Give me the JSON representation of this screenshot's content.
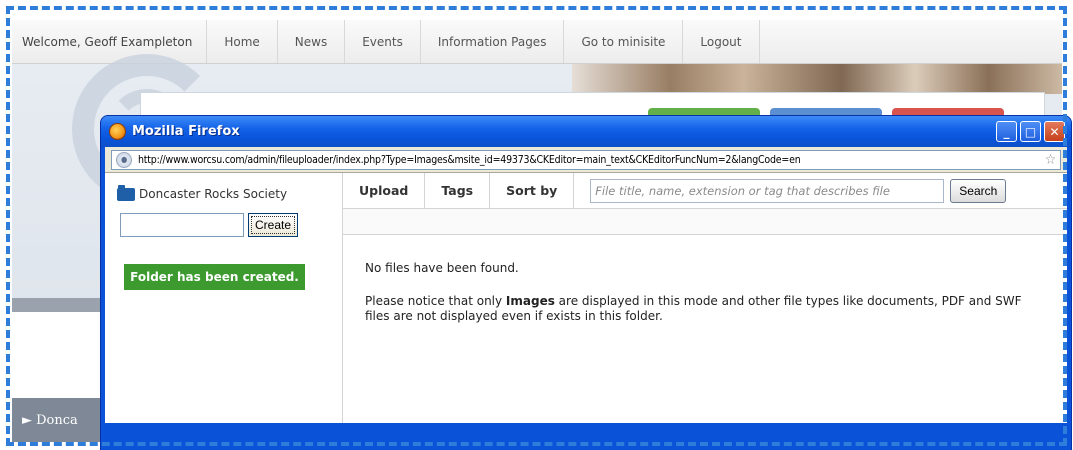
{
  "site": {
    "welcome": "Welcome, Geoff Exampleton",
    "nav": [
      "Home",
      "News",
      "Events",
      "Information Pages",
      "Go to minisite",
      "Logout"
    ],
    "side_item": "► Donca"
  },
  "firefox": {
    "title": "Mozilla Firefox",
    "url": "http://www.worcsu.com/admin/fileuploader/index.php?Type=Images&msite_id=49373&CKEditor=main_text&CKEditorFuncNum=2&langCode=en",
    "controls": {
      "minimize": "_",
      "maximize": "□",
      "close": "✕"
    }
  },
  "uploader": {
    "folder_name": "Doncaster Rocks Society",
    "create_input_value": "",
    "create_button": "Create",
    "created_message": "Folder has been created.",
    "toolbar": {
      "upload": "Upload",
      "tags": "Tags",
      "sort_by": "Sort by",
      "search_placeholder": "File title, name, extension or tag that describes file",
      "search_button": "Search"
    },
    "no_files": "No files have been found.",
    "notice_before": "Please notice that only ",
    "notice_bold": "Images",
    "notice_after": " are displayed in this mode and other file types like documents, PDF and SWF files are not displayed even if exists in this folder."
  },
  "colors": {
    "frame_dash": "#2f7ddb",
    "xp_title_blue": "#0a55dc",
    "success_green": "#3c9a2e",
    "folder_blue": "#1e5fa8"
  }
}
